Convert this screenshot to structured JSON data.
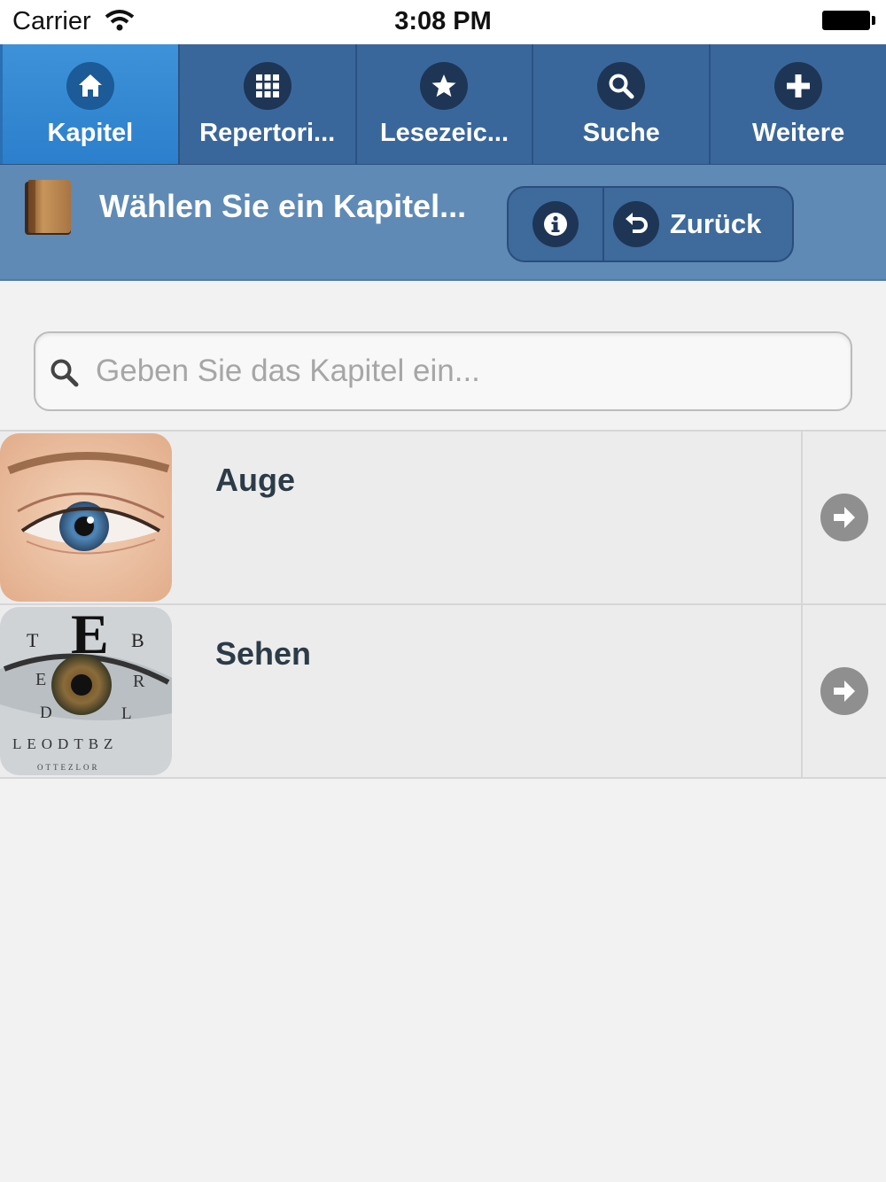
{
  "status_bar": {
    "carrier": "Carrier",
    "time": "3:08 PM"
  },
  "tabs": [
    {
      "label": "Kapitel",
      "icon": "home-icon",
      "active": true
    },
    {
      "label": "Repertori...",
      "icon": "grid-icon",
      "active": false
    },
    {
      "label": "Lesezeic...",
      "icon": "star-icon",
      "active": false
    },
    {
      "label": "Suche",
      "icon": "search-icon",
      "active": false
    },
    {
      "label": "Weitere",
      "icon": "plus-icon",
      "active": false
    }
  ],
  "header": {
    "title": "Wählen Sie ein Kapitel...",
    "info_icon": "info-icon",
    "back_label": "Zurück"
  },
  "search": {
    "placeholder": "Geben Sie das Kapitel ein...",
    "value": ""
  },
  "chapters": [
    {
      "label": "Auge",
      "thumbnail": "eye-photo"
    },
    {
      "label": "Sehen",
      "thumbnail": "eye-chart-photo"
    }
  ],
  "colors": {
    "tabbar": "#3a679b",
    "tab_active": "#2c7fcc",
    "header": "#5f8ab5",
    "background": "#f2f2f2",
    "row": "#ececec"
  }
}
